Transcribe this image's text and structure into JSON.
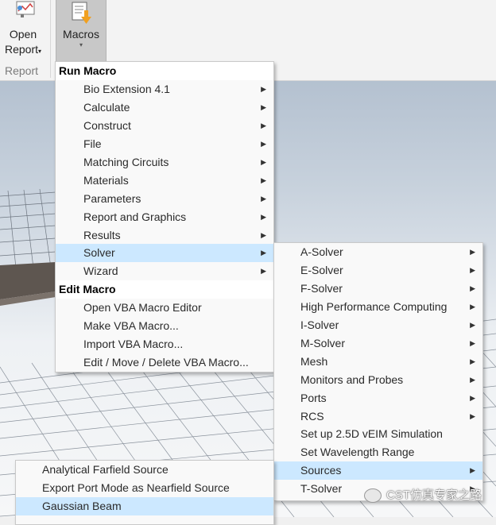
{
  "ribbon": {
    "open_report": {
      "line1": "Open",
      "line2": "Report",
      "caret": "▾"
    },
    "macros": {
      "label": "Macros",
      "caret": "▾"
    },
    "group_label": "Report"
  },
  "menu_macros": {
    "run_header": "Run Macro",
    "run_items": [
      {
        "label": "Bio Extension 4.1",
        "submenu": true
      },
      {
        "label": "Calculate",
        "submenu": true
      },
      {
        "label": "Construct",
        "submenu": true
      },
      {
        "label": "File",
        "submenu": true
      },
      {
        "label": "Matching Circuits",
        "submenu": true
      },
      {
        "label": "Materials",
        "submenu": true
      },
      {
        "label": "Parameters",
        "submenu": true
      },
      {
        "label": "Report and Graphics",
        "submenu": true
      },
      {
        "label": "Results",
        "submenu": true
      },
      {
        "label": "Solver",
        "submenu": true,
        "highlighted": true
      },
      {
        "label": "Wizard",
        "submenu": true
      }
    ],
    "edit_header": "Edit Macro",
    "edit_items": [
      {
        "label": "Open VBA Macro Editor"
      },
      {
        "label": "Make VBA Macro..."
      },
      {
        "label": "Import VBA Macro..."
      },
      {
        "label": "Edit / Move / Delete VBA Macro..."
      }
    ]
  },
  "menu_solver": {
    "items": [
      {
        "label": "A-Solver",
        "submenu": true
      },
      {
        "label": "E-Solver",
        "submenu": true
      },
      {
        "label": "F-Solver",
        "submenu": true
      },
      {
        "label": "High Performance Computing",
        "submenu": true
      },
      {
        "label": "I-Solver",
        "submenu": true
      },
      {
        "label": "M-Solver",
        "submenu": true
      },
      {
        "label": "Mesh",
        "submenu": true
      },
      {
        "label": "Monitors and Probes",
        "submenu": true
      },
      {
        "label": "Ports",
        "submenu": true
      },
      {
        "label": "RCS",
        "submenu": true
      },
      {
        "label": "Set up 2.5D vEIM Simulation",
        "submenu": false
      },
      {
        "label": "Set Wavelength Range",
        "submenu": false
      },
      {
        "label": "Sources",
        "submenu": true,
        "highlighted": true
      },
      {
        "label": "T-Solver",
        "submenu": true
      }
    ]
  },
  "menu_sources": {
    "items": [
      {
        "label": "Analytical Farfield Source"
      },
      {
        "label": "Export Port Mode as Nearfield Source"
      },
      {
        "label": "Gaussian Beam",
        "highlighted": true
      }
    ]
  },
  "watermark": {
    "text": "CST仿真专家之路"
  },
  "icons": {
    "submenu_arrow": "▶"
  },
  "colors": {
    "highlight": "#cce8ff",
    "menu_bg": "#f9f9f9",
    "ribbon_active": "#c8c8c8"
  }
}
